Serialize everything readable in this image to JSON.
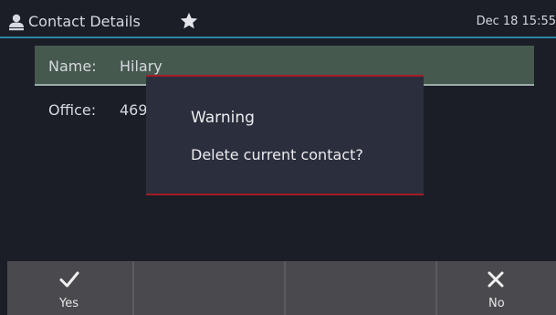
{
  "header": {
    "title": "Contact Details",
    "datetime": "Dec 18 15:55"
  },
  "contact": {
    "name_label": "Name:",
    "name_value": "Hilary",
    "office_label": "Office:",
    "office_value": "469"
  },
  "dialog": {
    "title": "Warning",
    "message": "Delete current contact?"
  },
  "softkeys": {
    "yes_label": "Yes",
    "no_label": "No"
  },
  "icons": {
    "contact": "person-icon",
    "favorite": "star-icon",
    "yes": "checkmark-icon",
    "no": "close-icon"
  },
  "colors": {
    "background": "#1b1d27",
    "accent_line": "#2f86a6",
    "selected_row": "#46594f",
    "dialog_border": "#a31d26",
    "softkey_bar": "#4a4a4e"
  }
}
